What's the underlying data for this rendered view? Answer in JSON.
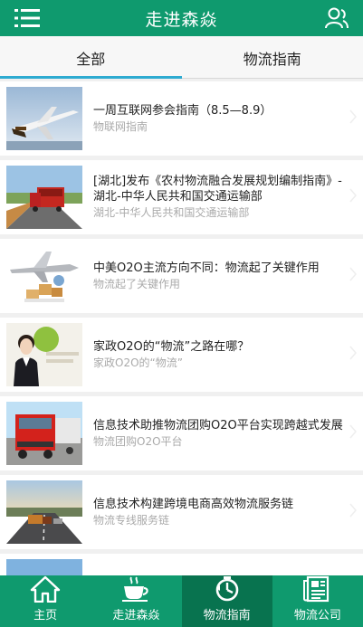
{
  "header": {
    "title": "走进森焱",
    "menu_icon": "menu-icon",
    "user_icon": "user-icon"
  },
  "tabs": [
    {
      "label": "全部",
      "active": true
    },
    {
      "label": "物流指南",
      "active": false
    }
  ],
  "articles": [
    {
      "title": "一周互联网参会指南（8.5—8.9）",
      "subtitle": "物联网指南",
      "image": "cargo-airplane"
    },
    {
      "title": "[湖北]发布《农村物流融合发展规划编制指南》-湖北-中华人民共和国交通运输部",
      "subtitle": "湖北-中华人民共和国交通运输部",
      "image": "red-truck-road"
    },
    {
      "title": "中美O2O主流方向不同：物流起了关键作用",
      "subtitle": "物流起了关键作用",
      "image": "airplane-parcels"
    },
    {
      "title": "家政O2O的“物流”之路在哪？",
      "subtitle": "家政O2O的“物流”",
      "image": "service-woman"
    },
    {
      "title": "信息技术助推物流团购O2O平台实现跨越式发展",
      "subtitle": "物流团购O2O平台",
      "image": "red-truck-front"
    },
    {
      "title": "信息技术构建跨境电商高效物流服务链",
      "subtitle": "物流专线服务链",
      "image": "trucks-highway"
    },
    {
      "title": "",
      "subtitle": "",
      "image": "partial-image"
    }
  ],
  "bottom_nav": [
    {
      "label": "主页",
      "icon": "home-icon",
      "active": false
    },
    {
      "label": "走进森焱",
      "icon": "coffee-cup-icon",
      "active": false
    },
    {
      "label": "物流指南",
      "icon": "timer-icon",
      "active": true
    },
    {
      "label": "物流公司",
      "icon": "newspaper-icon",
      "active": false
    }
  ],
  "colors": {
    "primary": "#0f9a6e",
    "primary_dark": "#08734f",
    "tab_indicator": "#2eabd1"
  }
}
